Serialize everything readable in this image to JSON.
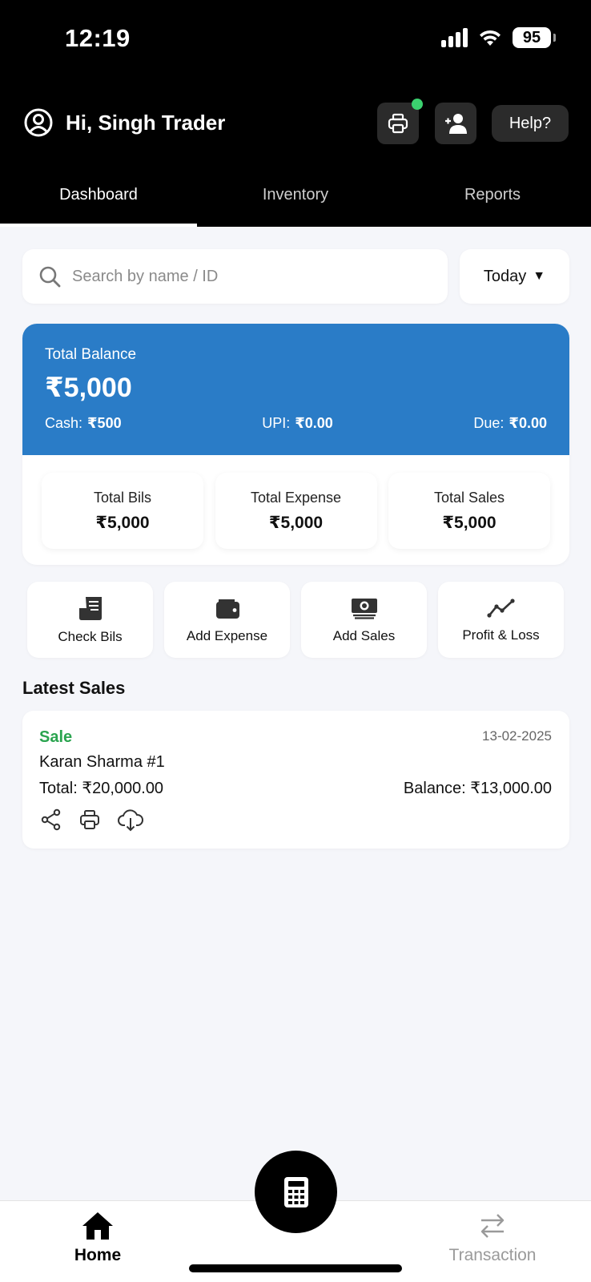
{
  "status_bar": {
    "time": "12:19",
    "battery": "95",
    "icons": [
      "signal-icon",
      "wifi-icon",
      "battery-icon"
    ]
  },
  "header": {
    "greeting": "Hi, Singh Trader",
    "help_label": "Help?",
    "icons": [
      "user-circle-icon",
      "printer-icon",
      "add-user-icon"
    ],
    "online_dot_color": "#3bd16f"
  },
  "tabs": [
    {
      "label": "Dashboard",
      "active": true
    },
    {
      "label": "Inventory",
      "active": false
    },
    {
      "label": "Reports",
      "active": false
    }
  ],
  "search": {
    "placeholder": "Search by name / ID",
    "value": ""
  },
  "period_filter": {
    "selected": "Today",
    "arrow": "▼"
  },
  "balance": {
    "label": "Total Balance",
    "value": "₹5,000",
    "accent_color": "#2a7cc7",
    "breakdown": [
      {
        "label": "Cash:",
        "value": "₹500"
      },
      {
        "label": "UPI:",
        "value": "₹0.00"
      },
      {
        "label": "Due:",
        "value": "₹0.00"
      }
    ]
  },
  "stats": [
    {
      "label": "Total Bils",
      "value": "₹5,000"
    },
    {
      "label": "Total Expense",
      "value": "₹5,000"
    },
    {
      "label": "Total Sales",
      "value": "₹5,000"
    }
  ],
  "actions": [
    {
      "label": "Check Bils",
      "icon": "receipt-icon"
    },
    {
      "label": "Add Expense",
      "icon": "wallet-icon"
    },
    {
      "label": "Add Sales",
      "icon": "cash-icon"
    },
    {
      "label": "Profit & Loss",
      "icon": "trend-icon"
    }
  ],
  "latest_sales": {
    "title": "Latest Sales",
    "items": [
      {
        "type": "Sale",
        "date": "13-02-2025",
        "name": "Karan Sharma #1",
        "total": "Total: ₹20,000.00",
        "balance": "Balance: ₹13,000.00",
        "type_color": "#2aa44f",
        "icons": [
          "share-icon",
          "printer-icon",
          "cloud-download-icon"
        ]
      }
    ]
  },
  "bottom_nav": {
    "home_label": "Home",
    "transaction_label": "Transaction",
    "fab_icon": "calculator-icon"
  }
}
